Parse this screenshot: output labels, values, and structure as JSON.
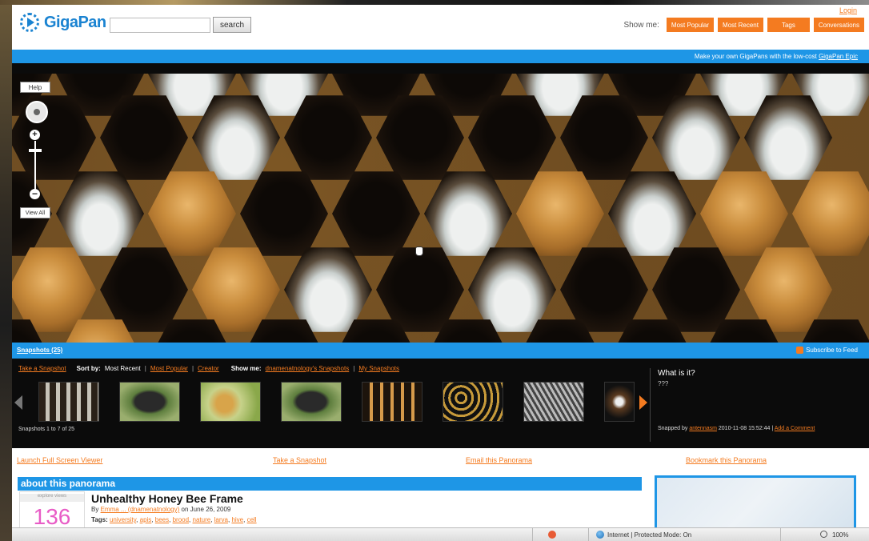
{
  "header": {
    "logo_text": "GigaPan",
    "search_button": "search",
    "login_link": "Login",
    "showme_label": "Show me:",
    "showme_buttons": [
      "Most Popular",
      "Most Recent",
      "Tags",
      "Conversations"
    ]
  },
  "promo": {
    "text": "Make your own GigaPans with the low-cost ",
    "link": "GigaPan Epic"
  },
  "viewer": {
    "help_label": "Help",
    "view_all_label": "View All"
  },
  "snapshots": {
    "title": "Snapshots (25)",
    "subscribe": "Subscribe to Feed",
    "take_snapshot": "Take a Snapshot",
    "sort_by_label": "Sort by:",
    "sort_most_recent": "Most Recent",
    "sort_most_popular": "Most Popular",
    "sort_creator": "Creator",
    "show_me_label": "Show me:",
    "show_me_snapshots": "dnamenatnology's Snapshots",
    "my_snapshots": "My Snapshots",
    "count_text": "Snapshots 1 to 7 of 25",
    "what_title": "What is it?",
    "what_text": "???",
    "snapped_by_prefix": "Snapped by ",
    "snapped_by_user": "antennasm",
    "snapped_by_date": " 2010-11-08 15:52:44 | ",
    "add_comment": "Add a Comment"
  },
  "links": {
    "full_screen": "Launch Full Screen Viewer",
    "take_snapshot": "Take a Snapshot",
    "email": "Email this Panorama",
    "bookmark": "Bookmark this Panorama"
  },
  "about": {
    "header": "about this panorama",
    "views_label": "explore views",
    "views_count": "136",
    "title": "Unhealthy Honey Bee Frame",
    "by_prefix": "By ",
    "by_author": "Emma ... (dnamenatnology)",
    "by_date": " on June 26, 2009",
    "tags_label": "Tags: ",
    "tags": [
      "university",
      "apis",
      "bees",
      "brood",
      "nature",
      "larva",
      "hive",
      "cell"
    ]
  },
  "status_bar": {
    "zone_text": "Internet | Protected Mode: On",
    "zoom": "100%"
  },
  "colors": {
    "accent_blue": "#1e96e6",
    "accent_orange": "#f47b20"
  }
}
